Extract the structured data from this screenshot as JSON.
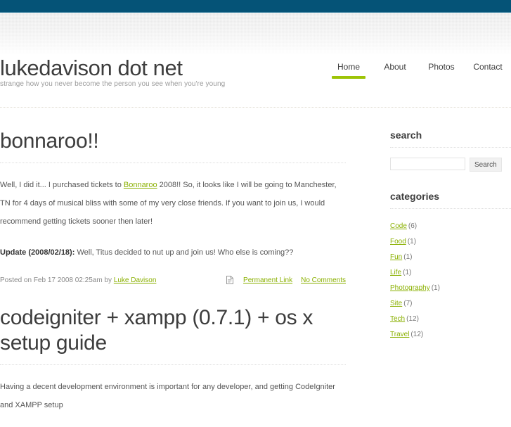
{
  "theme": {
    "topbar_color": "#055377",
    "accent_green": "#9dc406",
    "link_green": "#8ab000",
    "text_color": "#444444"
  },
  "header": {
    "site_title": "lukedavison dot net",
    "tagline": "strange how you never become the person you see when you're young",
    "nav": [
      {
        "label": "Home",
        "active": true
      },
      {
        "label": "About",
        "active": false
      },
      {
        "label": "Photos",
        "active": false
      },
      {
        "label": "Contact",
        "active": false
      }
    ]
  },
  "posts": [
    {
      "title": "bonnaroo!!",
      "paragraph_1_before_link": "Well, I did it... I purchased tickets to ",
      "paragraph_1_link": "Bonnaroo",
      "paragraph_1_after_link": " 2008!! So, it looks like I will be going to Manchester, TN for 4 days of musical bliss with some of my very close friends. If you want to join us, I would recommend getting tickets sooner then later!",
      "update_label": "Update (2008/02/18):",
      "update_text": " Well, Titus decided to nut up and join us! Who else is coming??",
      "meta_posted": "Posted on Feb 17 2008 02:25am by ",
      "meta_author": "Luke Davison",
      "meta_permalink": "Permanent Link",
      "meta_comments": "No Comments",
      "meta_icon": "document-icon"
    },
    {
      "title": "codeigniter + xampp (0.7.1) + os x setup guide",
      "paragraph_1": "Having a decent development environment is important for any developer, and getting CodeIgniter and XAMPP setup"
    }
  ],
  "sidebar": {
    "search": {
      "title": "search",
      "input_value": "",
      "input_placeholder": "",
      "button_label": "Search"
    },
    "categories": {
      "title": "categories",
      "items": [
        {
          "label": "Code",
          "count": "(6)"
        },
        {
          "label": "Food",
          "count": "(1)"
        },
        {
          "label": "Fun",
          "count": "(1)"
        },
        {
          "label": "Life",
          "count": "(1)"
        },
        {
          "label": "Photography",
          "count": "(1)"
        },
        {
          "label": "Site",
          "count": "(7)"
        },
        {
          "label": "Tech",
          "count": "(12)"
        },
        {
          "label": "Travel",
          "count": "(12)"
        }
      ]
    }
  }
}
